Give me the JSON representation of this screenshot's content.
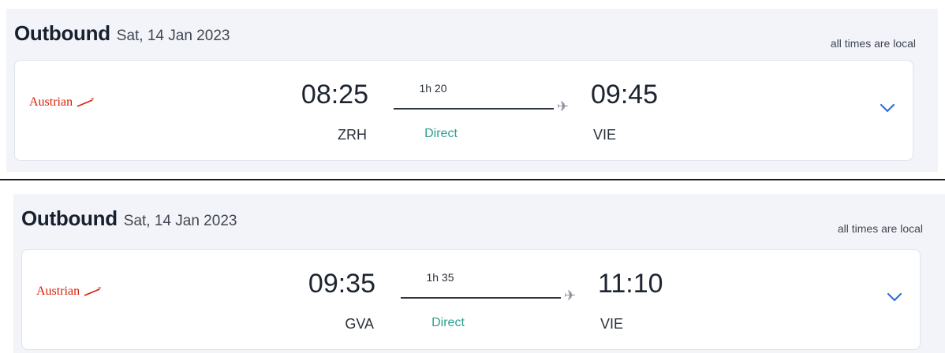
{
  "flights": [
    {
      "header": {
        "title": "Outbound",
        "date": "Sat, 14 Jan 2023",
        "note": "all times are local"
      },
      "airline": "Austrian",
      "departure": {
        "time": "08:25",
        "code": "ZRH"
      },
      "arrival": {
        "time": "09:45",
        "code": "VIE"
      },
      "duration": "1h 20",
      "stops": "Direct"
    },
    {
      "header": {
        "title": "Outbound",
        "date": "Sat, 14 Jan 2023",
        "note": "all times are local"
      },
      "airline": "Austrian",
      "departure": {
        "time": "09:35",
        "code": "GVA"
      },
      "arrival": {
        "time": "11:10",
        "code": "VIE"
      },
      "duration": "1h 35",
      "stops": "Direct"
    }
  ],
  "colors": {
    "section_bg": "#f3f4f9",
    "airline_red": "#d81e05",
    "direct_green": "#2c9e8f",
    "chevron_blue": "#2f6fe0"
  },
  "icons": {
    "airline_logo": "austrian-arrow-icon",
    "plane": "plane-icon",
    "expand": "chevron-down-icon"
  }
}
